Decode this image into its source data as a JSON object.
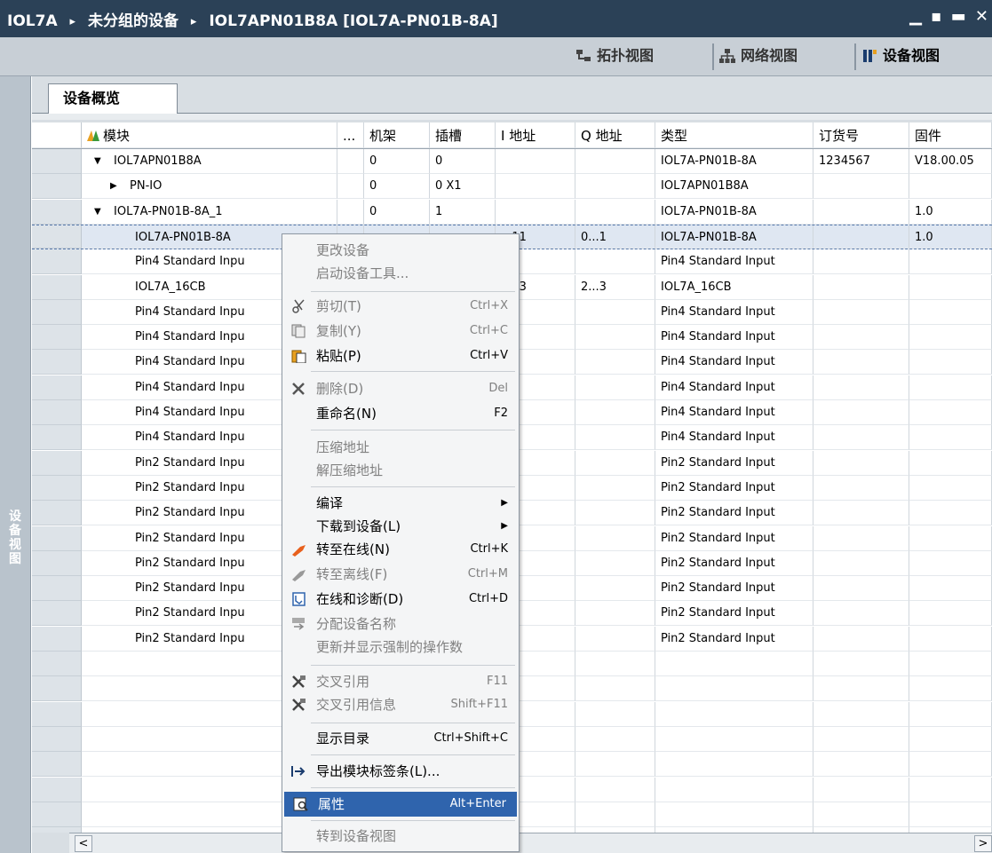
{
  "titlebar": {
    "crumb1": "IOL7A",
    "crumb2": "未分组的设备",
    "crumb3": "IOL7APN01B8A [IOL7A-PN01B-8A]",
    "sep": "▸",
    "controls": "▁ ▪ ▬ ✕"
  },
  "viewbar": {
    "topology": "拓扑视图",
    "network": "网络视图",
    "device": "设备视图"
  },
  "side": {
    "vertical_label": "设备视图"
  },
  "tab": {
    "label": "设备概览"
  },
  "table": {
    "headers": [
      "模块",
      "...",
      "机架",
      "插槽",
      "I 地址",
      "Q 地址",
      "类型",
      "订货号",
      "固件"
    ],
    "rows": [
      {
        "expander": "▼",
        "module": "IOL7APN01B8A",
        "rack": "0",
        "slot": "0",
        "iaddr": "",
        "qaddr": "",
        "type": "IOL7A-PN01B-8A",
        "order": "1234567",
        "fw": "V18.00.05"
      },
      {
        "expander": "▶",
        "module": "PN-IO",
        "rack": "0",
        "slot": "0 X1",
        "iaddr": "",
        "qaddr": "",
        "type": "IOL7APN01B8A",
        "order": "",
        "fw": ""
      },
      {
        "expander": "▼",
        "module": "IOL7A-PN01B-8A_1",
        "rack": "0",
        "slot": "1",
        "iaddr": "",
        "qaddr": "",
        "type": "IOL7A-PN01B-8A",
        "order": "",
        "fw": "1.0"
      },
      {
        "expander": "",
        "module": "IOL7A-PN01B-8A",
        "rack": "",
        "slot": "",
        "iaddr": "...11",
        "qaddr": "0...1",
        "type": "IOL7A-PN01B-8A",
        "order": "",
        "fw": "1.0"
      },
      {
        "expander": "",
        "module": "Pin4 Standard Inpu",
        "rack": "",
        "slot": "",
        "iaddr": "",
        "qaddr": "",
        "type": "Pin4 Standard Input",
        "order": "",
        "fw": ""
      },
      {
        "expander": "",
        "module": "IOL7A_16CB",
        "rack": "",
        "slot": "",
        "iaddr": "...13",
        "qaddr": "2...3",
        "type": "IOL7A_16CB",
        "order": "",
        "fw": ""
      },
      {
        "expander": "",
        "module": "Pin4 Standard Inpu",
        "rack": "",
        "slot": "",
        "iaddr": "",
        "qaddr": "",
        "type": "Pin4 Standard Input",
        "order": "",
        "fw": ""
      },
      {
        "expander": "",
        "module": "Pin4 Standard Inpu",
        "rack": "",
        "slot": "",
        "iaddr": "",
        "qaddr": "",
        "type": "Pin4 Standard Input",
        "order": "",
        "fw": ""
      },
      {
        "expander": "",
        "module": "Pin4 Standard Inpu",
        "rack": "",
        "slot": "",
        "iaddr": "",
        "qaddr": "",
        "type": "Pin4 Standard Input",
        "order": "",
        "fw": ""
      },
      {
        "expander": "",
        "module": "Pin4 Standard Inpu",
        "rack": "",
        "slot": "",
        "iaddr": "",
        "qaddr": "",
        "type": "Pin4 Standard Input",
        "order": "",
        "fw": ""
      },
      {
        "expander": "",
        "module": "Pin4 Standard Inpu",
        "rack": "",
        "slot": "",
        "iaddr": "",
        "qaddr": "",
        "type": "Pin4 Standard Input",
        "order": "",
        "fw": ""
      },
      {
        "expander": "",
        "module": "Pin4 Standard Inpu",
        "rack": "",
        "slot": "",
        "iaddr": "",
        "qaddr": "",
        "type": "Pin4 Standard Input",
        "order": "",
        "fw": ""
      },
      {
        "expander": "",
        "module": "Pin2 Standard Inpu",
        "rack": "",
        "slot": "",
        "iaddr": "",
        "qaddr": "",
        "type": "Pin2 Standard Input",
        "order": "",
        "fw": ""
      },
      {
        "expander": "",
        "module": "Pin2 Standard Inpu",
        "rack": "",
        "slot": "",
        "iaddr": "",
        "qaddr": "",
        "type": "Pin2 Standard Input",
        "order": "",
        "fw": ""
      },
      {
        "expander": "",
        "module": "Pin2 Standard Inpu",
        "rack": "",
        "slot": "",
        "iaddr": "",
        "qaddr": "",
        "type": "Pin2 Standard Input",
        "order": "",
        "fw": ""
      },
      {
        "expander": "",
        "module": "Pin2 Standard Inpu",
        "rack": "",
        "slot": "",
        "iaddr": "",
        "qaddr": "",
        "type": "Pin2 Standard Input",
        "order": "",
        "fw": ""
      },
      {
        "expander": "",
        "module": "Pin2 Standard Inpu",
        "rack": "",
        "slot": "",
        "iaddr": "",
        "qaddr": "",
        "type": "Pin2 Standard Input",
        "order": "",
        "fw": ""
      },
      {
        "expander": "",
        "module": "Pin2 Standard Inpu",
        "rack": "",
        "slot": "",
        "iaddr": "",
        "qaddr": "",
        "type": "Pin2 Standard Input",
        "order": "",
        "fw": ""
      },
      {
        "expander": "",
        "module": "Pin2 Standard Inpu",
        "rack": "",
        "slot": "",
        "iaddr": "",
        "qaddr": "",
        "type": "Pin2 Standard Input",
        "order": "",
        "fw": ""
      },
      {
        "expander": "",
        "module": "Pin2 Standard Inpu",
        "rack": "",
        "slot": "",
        "iaddr": "",
        "qaddr": "",
        "type": "Pin2 Standard Input",
        "order": "",
        "fw": ""
      }
    ]
  },
  "menu": {
    "change_device": "更改设备",
    "start_tool": "启动设备工具...",
    "cut": "剪切(T)",
    "cut_sc": "Ctrl+X",
    "copy": "复制(Y)",
    "copy_sc": "Ctrl+C",
    "paste": "粘贴(P)",
    "paste_sc": "Ctrl+V",
    "delete": "删除(D)",
    "delete_sc": "Del",
    "rename": "重命名(N)",
    "rename_sc": "F2",
    "compress": "压缩地址",
    "decompress": "解压缩地址",
    "compile": "编译",
    "download": "下载到设备(L)",
    "go_online": "转至在线(N)",
    "go_online_sc": "Ctrl+K",
    "go_offline": "转至离线(F)",
    "go_offline_sc": "Ctrl+M",
    "diag": "在线和诊断(D)",
    "diag_sc": "Ctrl+D",
    "assign_name": "分配设备名称",
    "update_force": "更新并显示强制的操作数",
    "xref": "交叉引用",
    "xref_sc": "F11",
    "xref_info": "交叉引用信息",
    "xref_info_sc": "Shift+F11",
    "catalog": "显示目录",
    "catalog_sc": "Ctrl+Shift+C",
    "export_labels": "导出模块标签条(L)...",
    "properties": "属性",
    "properties_sc": "Alt+Enter",
    "goto_device_view": "转到设备视图"
  },
  "colors": {
    "title_bg": "#2b4157",
    "highlight": "#2f64ad"
  }
}
